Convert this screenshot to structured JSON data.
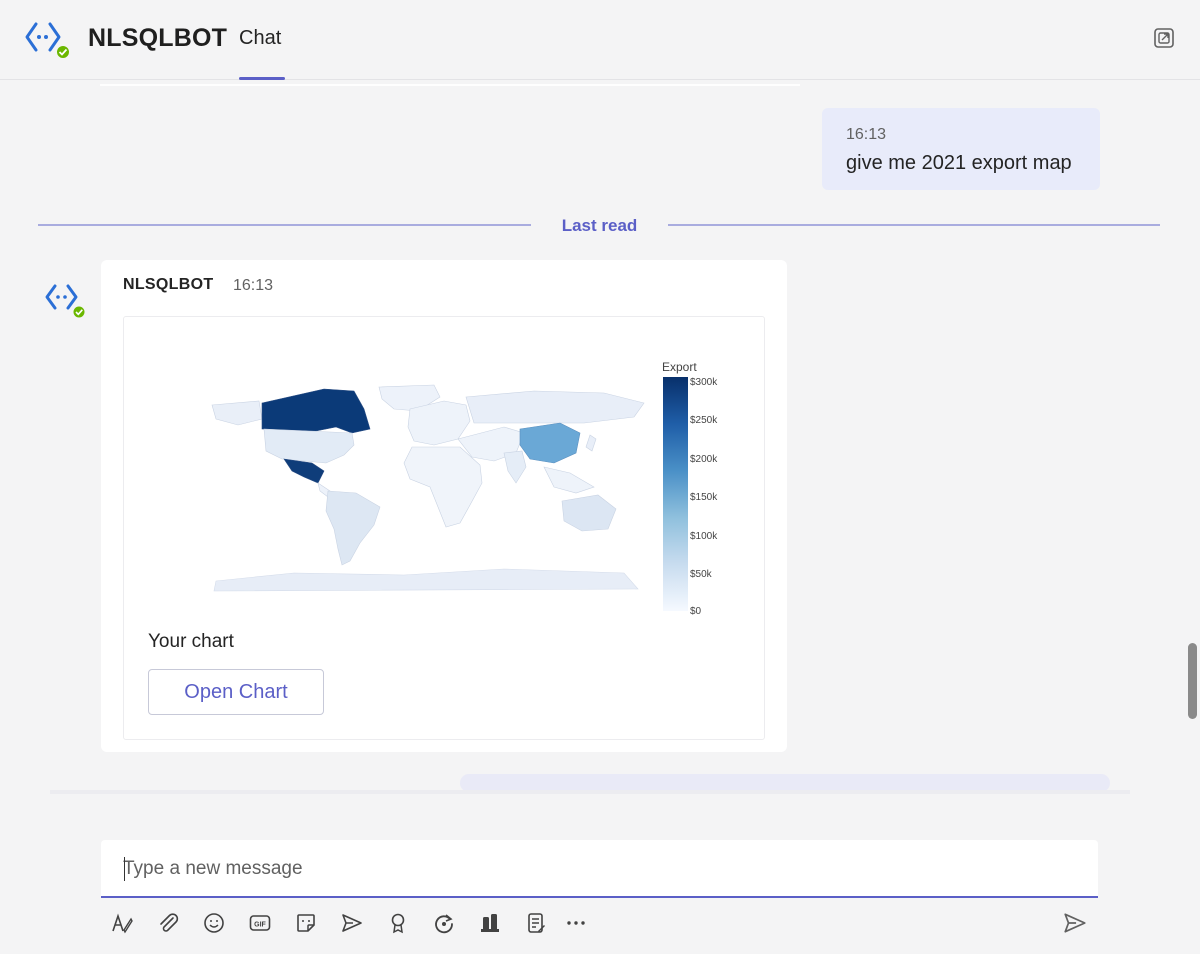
{
  "header": {
    "bot_name": "NLSQLBOT",
    "tab_label": "Chat",
    "icons": [
      "bot-avatar-icon",
      "popout-icon"
    ]
  },
  "messages": {
    "user_message": {
      "time": "16:13",
      "text": "give me 2021 export map"
    },
    "last_read_label": "Last read",
    "bot_message": {
      "sender": "NLSQLBOT",
      "time": "16:13",
      "caption": "Your chart",
      "button_label": "Open Chart"
    }
  },
  "chart_data": {
    "type": "choropleth",
    "colorbar_title": "Export",
    "colorbar_ticks": [
      "$300k",
      "$250k",
      "$200k",
      "$150k",
      "$100k",
      "$50k",
      "$0"
    ],
    "colorbar_range": [
      0,
      300000
    ],
    "colorscale": [
      "#f5f9ff",
      "#08306b"
    ]
  },
  "compose": {
    "placeholder": "Type a new message",
    "value": ""
  },
  "toolbar": {
    "icons": [
      "format-icon",
      "attach-icon",
      "emoji-icon",
      "gif-icon",
      "sticker-icon",
      "schedule-send-icon",
      "praise-icon",
      "loop-icon",
      "apps-icon",
      "forms-icon",
      "more-icon"
    ],
    "send_icon": "send-icon"
  },
  "colors": {
    "accent": "#5b5fc7",
    "user_bubble": "#e8ebfa",
    "background": "#f4f4f5"
  }
}
